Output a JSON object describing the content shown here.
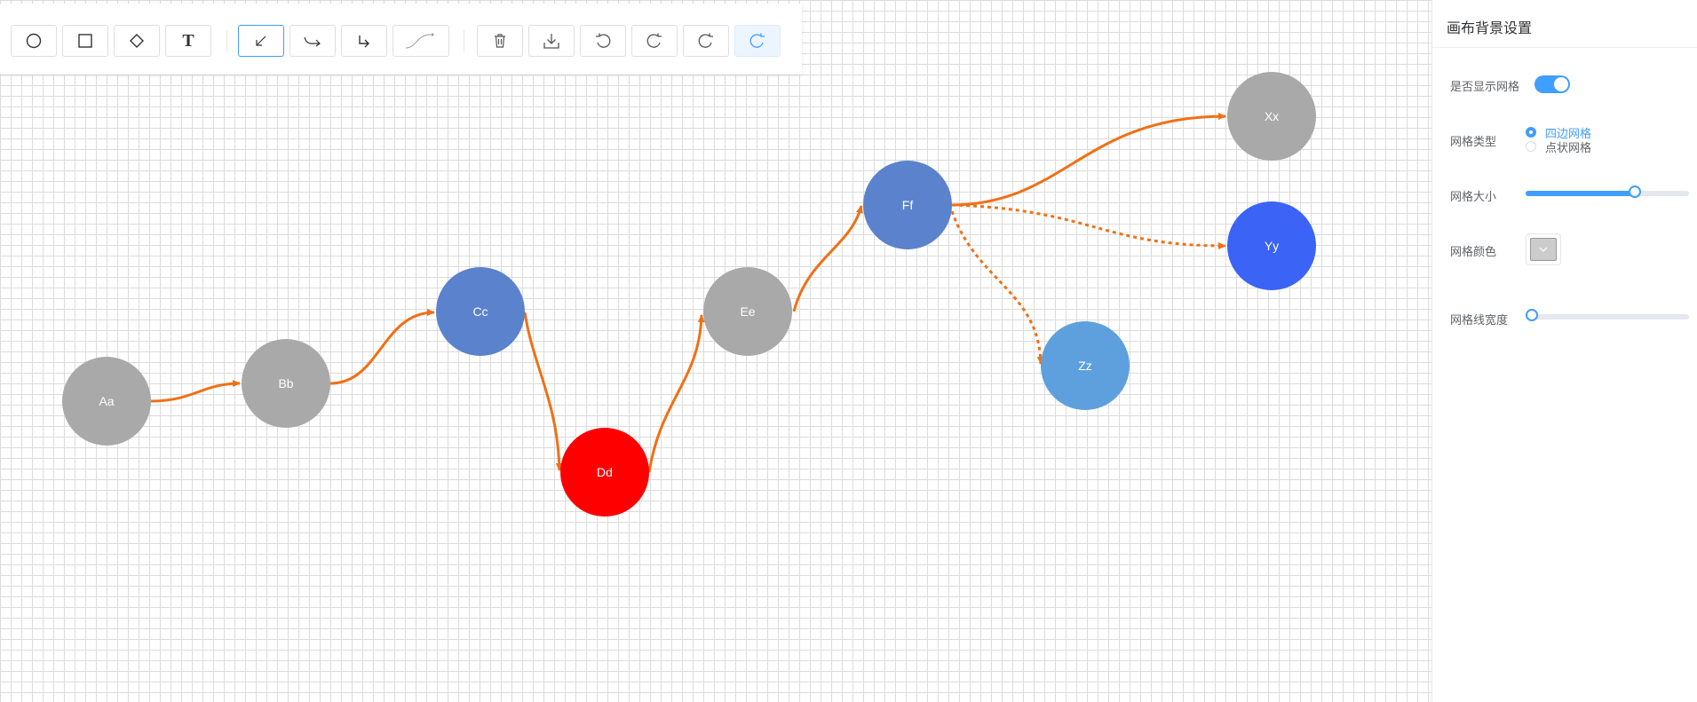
{
  "toolbar": {
    "tools": [
      {
        "name": "circle-tool",
        "icon": "circle-icon"
      },
      {
        "name": "rectangle-tool",
        "icon": "square-icon"
      },
      {
        "name": "diamond-tool",
        "icon": "diamond-icon"
      },
      {
        "name": "text-tool",
        "icon": "text-icon",
        "glyph": "T"
      },
      {
        "name": "straight-edge-tool",
        "icon": "arrow-down-left-icon",
        "active": true
      },
      {
        "name": "polyline-edge-tool",
        "icon": "curved-arrow-icon"
      },
      {
        "name": "orthogonal-edge-tool",
        "icon": "corner-arrow-icon"
      },
      {
        "name": "bezier-edge-tool",
        "icon": "bezier-curve-icon"
      },
      {
        "name": "delete-button",
        "icon": "trash-icon"
      },
      {
        "name": "download-button",
        "icon": "download-icon"
      },
      {
        "name": "undo-button",
        "icon": "undo-icon"
      },
      {
        "name": "redo-button",
        "icon": "redo-icon"
      },
      {
        "name": "redo-alt-button",
        "icon": "redo-icon"
      },
      {
        "name": "refresh-button",
        "icon": "redo-icon",
        "highlighted": true
      }
    ]
  },
  "graph": {
    "nodes": [
      {
        "id": "Aa",
        "label": "Aa",
        "color": "#a9a9a9"
      },
      {
        "id": "Bb",
        "label": "Bb",
        "color": "#a9a9a9"
      },
      {
        "id": "Cc",
        "label": "Cc",
        "color": "#5b82cc"
      },
      {
        "id": "Dd",
        "label": "Dd",
        "color": "#ff0000"
      },
      {
        "id": "Ee",
        "label": "Ee",
        "color": "#a9a9a9"
      },
      {
        "id": "Ff",
        "label": "Ff",
        "color": "#5b82cc"
      },
      {
        "id": "Xx",
        "label": "Xx",
        "color": "#a9a9a9"
      },
      {
        "id": "Yy",
        "label": "Yy",
        "color": "#3b63f5"
      },
      {
        "id": "Zz",
        "label": "Zz",
        "color": "#5ea0dd"
      }
    ],
    "edges": [
      {
        "from": "Aa",
        "to": "Bb",
        "style": "solid"
      },
      {
        "from": "Bb",
        "to": "Cc",
        "style": "solid"
      },
      {
        "from": "Cc",
        "to": "Dd",
        "style": "solid"
      },
      {
        "from": "Dd",
        "to": "Ee",
        "style": "solid"
      },
      {
        "from": "Ee",
        "to": "Ff",
        "style": "solid"
      },
      {
        "from": "Ff",
        "to": "Xx",
        "style": "solid"
      },
      {
        "from": "Ff",
        "to": "Yy",
        "style": "dashed"
      },
      {
        "from": "Ff",
        "to": "Zz",
        "style": "dashed"
      }
    ],
    "edge_color": "#f07015",
    "grid_line_color": "#dcdcdc"
  },
  "panel": {
    "title": "画布背景设置",
    "show_grid_label": "是否显示网格",
    "show_grid": true,
    "grid_type_label": "网格类型",
    "grid_type_options": [
      "四边网格",
      "点状网格"
    ],
    "grid_type_selected": "四边网格",
    "grid_size_label": "网格大小",
    "grid_size_fraction": 0.67,
    "grid_color_label": "网格颜色",
    "grid_color_value": "#cccccc",
    "grid_line_width_label": "网格线宽度",
    "grid_line_width_fraction": 0.0,
    "accent_color": "#409eff"
  }
}
